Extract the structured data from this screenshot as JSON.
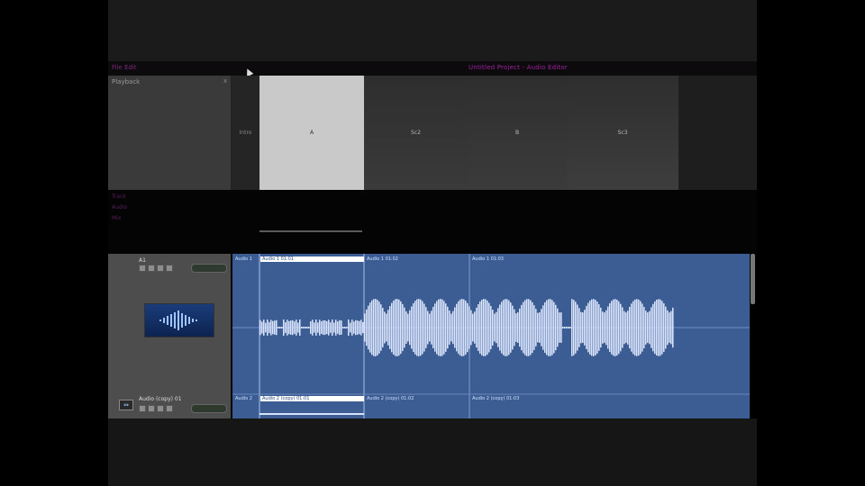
{
  "menubar": {
    "left": "File Edit",
    "center": "Untitled Project - Audio Editor"
  },
  "viewer": {
    "title": "Playback",
    "close": "x"
  },
  "clips": [
    {
      "label": "Intro"
    },
    {
      "label": "A"
    },
    {
      "label": "Sc2"
    },
    {
      "label": "B"
    },
    {
      "label": "Sc3"
    },
    {
      "label": ""
    }
  ],
  "middle": {
    "labels": [
      "Track",
      "Audio",
      "Mix"
    ]
  },
  "track": {
    "name": "A1",
    "name_bottom": "Audio (copy) 01",
    "expand_icon": "expand-icon"
  },
  "segments_top": [
    {
      "label": "Audio 1"
    },
    {
      "label": "Audio 1 01:01"
    },
    {
      "label": "Audio 1 01:02"
    },
    {
      "label": "Audio 1 01:03"
    }
  ],
  "segments_bottom": [
    {
      "label": "Audio 2"
    },
    {
      "label": "Audio 2 (copy) 01:01"
    },
    {
      "label": "Audio 2 (copy) 01:02"
    },
    {
      "label": "Audio 2 (copy) 01:03"
    }
  ],
  "colors": {
    "waveform_bg": "#3b5d93",
    "waveform_fill": "#dde6ff",
    "accent_magenta": "#a020a0"
  }
}
